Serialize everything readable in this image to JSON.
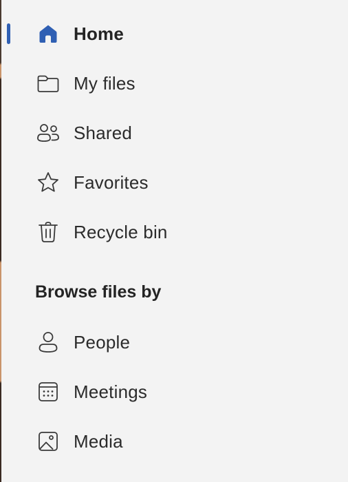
{
  "nav": {
    "items": [
      {
        "id": "home",
        "label": "Home",
        "icon": "home-icon",
        "active": true
      },
      {
        "id": "my-files",
        "label": "My files",
        "icon": "folder-icon",
        "active": false
      },
      {
        "id": "shared",
        "label": "Shared",
        "icon": "people-icon",
        "active": false
      },
      {
        "id": "favorites",
        "label": "Favorites",
        "icon": "star-icon",
        "active": false
      },
      {
        "id": "recycle-bin",
        "label": "Recycle bin",
        "icon": "trash-icon",
        "active": false
      }
    ],
    "section_heading": "Browse files by",
    "browse_items": [
      {
        "id": "people",
        "label": "People",
        "icon": "person-icon"
      },
      {
        "id": "meetings",
        "label": "Meetings",
        "icon": "calendar-icon"
      },
      {
        "id": "media",
        "label": "Media",
        "icon": "image-icon"
      }
    ]
  },
  "colors": {
    "background": "#f3f3f3",
    "accent": "#2f5fb3",
    "text": "#2b2b2b"
  }
}
